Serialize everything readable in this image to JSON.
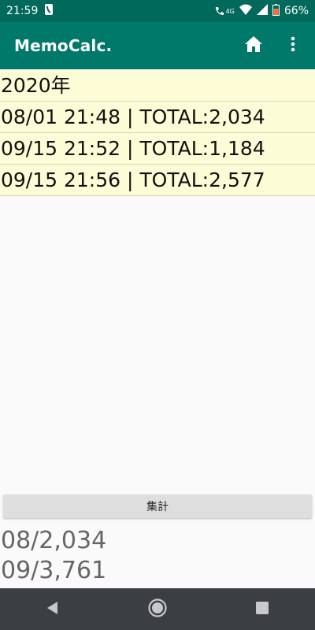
{
  "status": {
    "time": "21:59",
    "network": "4G",
    "battery": "66%"
  },
  "app_bar": {
    "title": "MemoCalc."
  },
  "list": {
    "year_header": "2020年",
    "rows": [
      "08/01 21:48  | TOTAL:2,034",
      "09/15 21:52  | TOTAL:1,184",
      "09/15 21:56  | TOTAL:2,577"
    ]
  },
  "summary_button": {
    "label": "集計"
  },
  "results": [
    "08/2,034",
    "09/3,761"
  ],
  "colors": {
    "status_bar": "#00695c",
    "app_bar": "#00796b",
    "row_bg": "#fcfcd6",
    "nav_bar": "#3b3f44"
  },
  "icons": {
    "status_left": "phone-handset-icon",
    "status_right": [
      "wifi-call-icon",
      "wifi-icon",
      "cell-signal-icon",
      "battery-icon"
    ],
    "app_actions": [
      "home-icon",
      "overflow-menu-icon"
    ],
    "nav": [
      "back-icon",
      "home-circle-icon",
      "recents-icon"
    ]
  }
}
